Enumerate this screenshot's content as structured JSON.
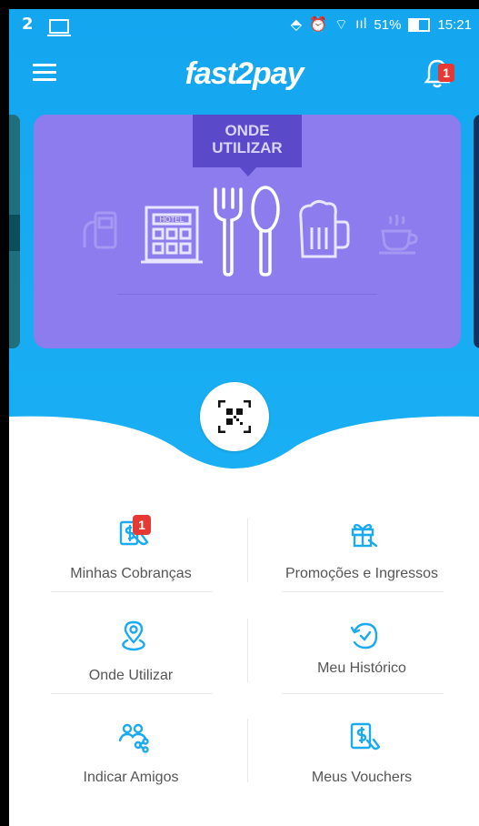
{
  "status": {
    "left_text": "2",
    "battery": "51%",
    "time": "15:21"
  },
  "app": {
    "logo": "fast2pay",
    "notification_count": "1",
    "accent": "#1aaaf2"
  },
  "banner": {
    "tag_line1": "ONDE",
    "tag_line2": "UTILIZAR",
    "hotel_sign": "HOTEL"
  },
  "menu": {
    "cobrancas": {
      "label": "Minhas Cobranças",
      "icon": "receipt-dollar-icon",
      "badge": "1"
    },
    "promocoes": {
      "label": "Promoções e Ingressos",
      "icon": "gift-icon"
    },
    "onde": {
      "label": "Onde Utilizar",
      "icon": "location-pin-icon"
    },
    "historico": {
      "label": "Meu Histórico",
      "icon": "history-icon"
    },
    "indicar": {
      "label": "Indicar Amigos",
      "icon": "share-people-icon"
    },
    "vouchers": {
      "label": "Meus Vouchers",
      "icon": "voucher-icon"
    }
  }
}
